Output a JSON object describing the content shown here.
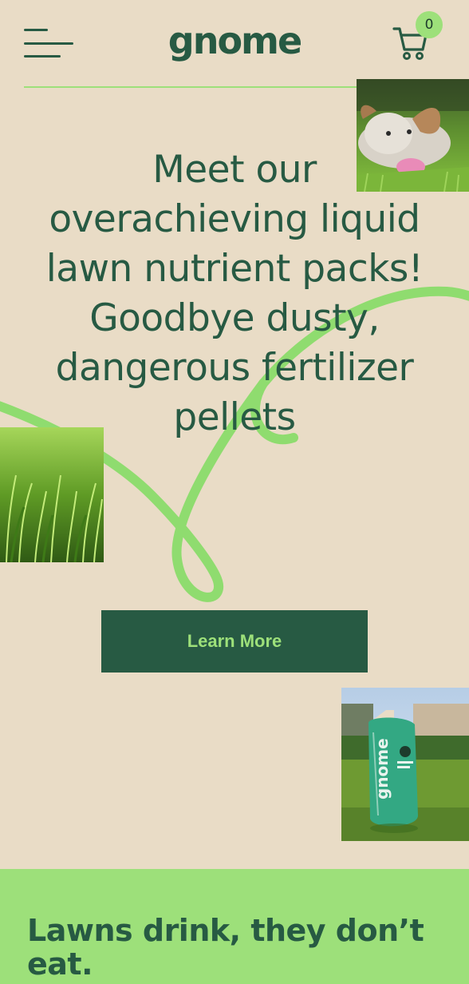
{
  "header": {
    "logo_text": "gnome",
    "cart_count": "0"
  },
  "hero": {
    "title": "Meet our overachieving liquid lawn nutrient packs! Goodbye dusty, dangerous fertilizer pellets",
    "cta_label": "Learn More"
  },
  "section": {
    "title": "Lawns drink, they don’t eat."
  },
  "icons": {
    "menu": "hamburger-icon",
    "cart": "cart-icon"
  },
  "colors": {
    "background": "#e9dcc6",
    "brand_dark": "#275a43",
    "brand_light": "#9de07a"
  }
}
